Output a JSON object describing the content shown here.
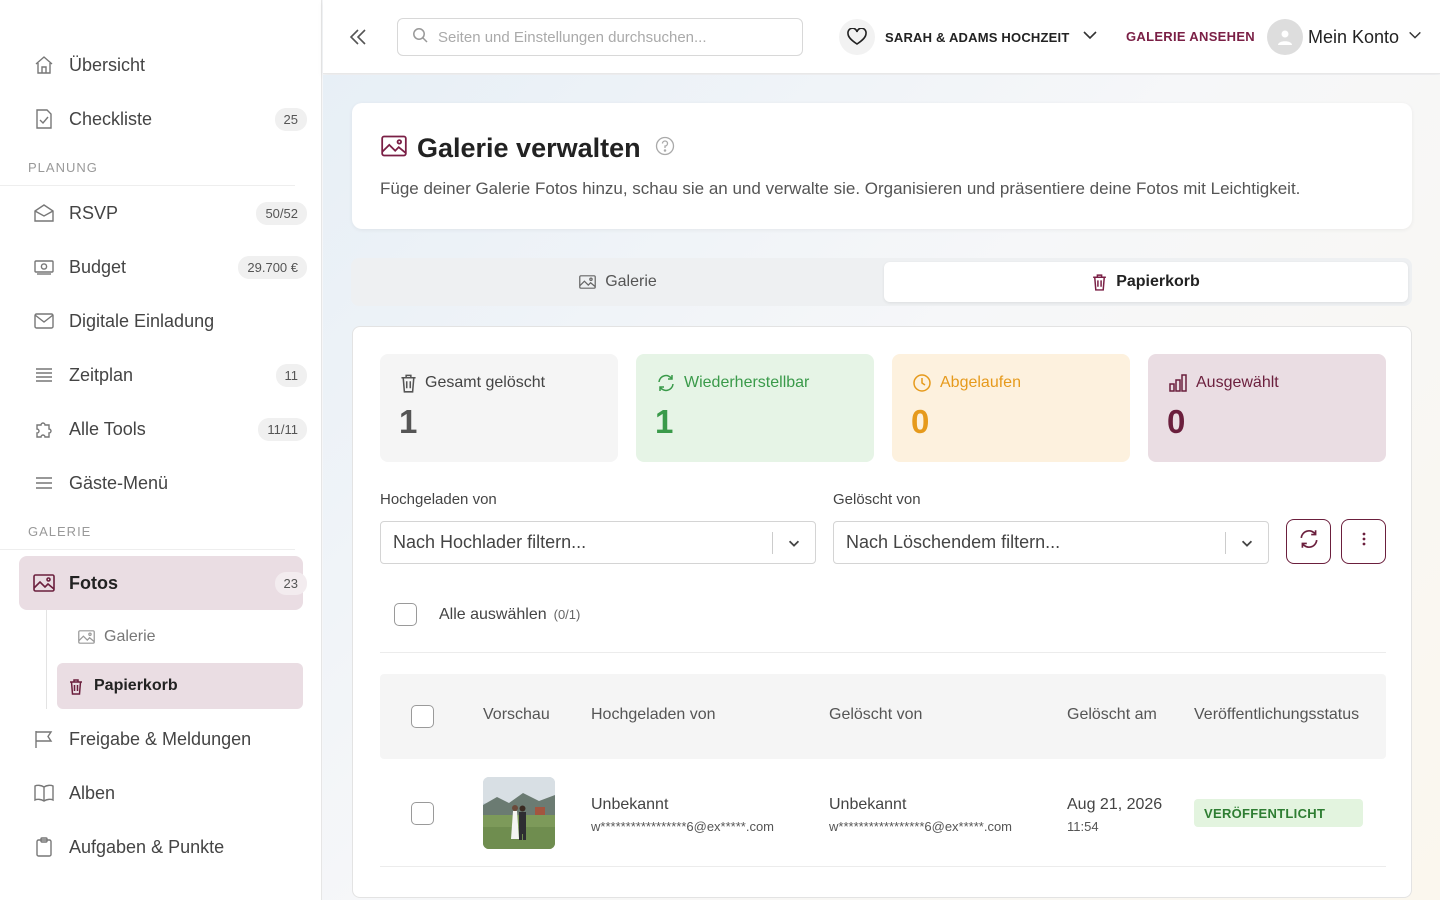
{
  "sidebar": {
    "items_top": [
      {
        "label": "Übersicht",
        "icon": "home-icon",
        "badge": ""
      },
      {
        "label": "Checkliste",
        "icon": "checklist-icon",
        "badge": "25"
      }
    ],
    "section_planung": "PLANUNG",
    "items_planung": [
      {
        "label": "RSVP",
        "icon": "envelope-open-icon",
        "badge": "50/52"
      },
      {
        "label": "Budget",
        "icon": "money-icon",
        "badge": "29.700 €"
      },
      {
        "label": "Digitale Einladung",
        "icon": "mail-icon",
        "badge": ""
      },
      {
        "label": "Zeitplan",
        "icon": "list-icon",
        "badge": "11"
      },
      {
        "label": "Alle Tools",
        "icon": "puzzle-icon",
        "badge": "11/11"
      },
      {
        "label": "Gäste-Menü",
        "icon": "menu-icon",
        "badge": ""
      }
    ],
    "section_galerie": "GALERIE",
    "fotos": {
      "label": "Fotos",
      "badge": "23"
    },
    "sub_items": [
      {
        "label": "Galerie"
      },
      {
        "label": "Papierkorb"
      }
    ],
    "items_bottom": [
      {
        "label": "Freigabe & Meldungen",
        "icon": "flag-icon"
      },
      {
        "label": "Alben",
        "icon": "book-icon"
      },
      {
        "label": "Aufgaben & Punkte",
        "icon": "clipboard-icon"
      }
    ]
  },
  "topbar": {
    "search_placeholder": "Seiten und Einstellungen durchsuchen...",
    "wedding_name": "SARAH & ADAMS HOCHZEIT",
    "gallery_link": "GALERIE ANSEHEN",
    "account_label": "Mein Konto"
  },
  "header": {
    "title": "Galerie verwalten",
    "description": "Füge deiner Galerie Fotos hinzu, schau sie an und verwalte sie. Organisieren und präsentiere deine Fotos mit Leichtigkeit."
  },
  "tabs": [
    {
      "label": "Galerie",
      "active": false
    },
    {
      "label": "Papierkorb",
      "active": true
    }
  ],
  "stats": [
    {
      "label": "Gesamt gelöscht",
      "value": "1",
      "color": "#555555"
    },
    {
      "label": "Wiederherstellbar",
      "value": "1",
      "color": "#3a9a4a"
    },
    {
      "label": "Abgelaufen",
      "value": "0",
      "color": "#e69a1c"
    },
    {
      "label": "Ausgewählt",
      "value": "0",
      "color": "#6b1f3d"
    }
  ],
  "filters": {
    "uploaded_by_label": "Hochgeladen von",
    "uploaded_by_value": "Nach Hochlader filtern...",
    "deleted_by_label": "Gelöscht von",
    "deleted_by_value": "Nach Löschendem filtern..."
  },
  "select_all": {
    "label": "Alle auswählen",
    "count": "(0/1)"
  },
  "table": {
    "headers": [
      "Vorschau",
      "Hochgeladen von",
      "Gelöscht von",
      "Gelöscht am",
      "Veröffentlichungsstatus"
    ],
    "rows": [
      {
        "uploaded_by_name": "Unbekannt",
        "uploaded_by_email": "w*****************6@ex*****.com",
        "deleted_by_name": "Unbekannt",
        "deleted_by_email": "w*****************6@ex*****.com",
        "deleted_date": "Aug 21, 2026",
        "deleted_time": "11:54",
        "status": "VERÖFFENTLICHT"
      }
    ]
  },
  "colors": {
    "brand": "#6b1f3d",
    "success": "#3a9a4a",
    "warning": "#e69a1c"
  }
}
